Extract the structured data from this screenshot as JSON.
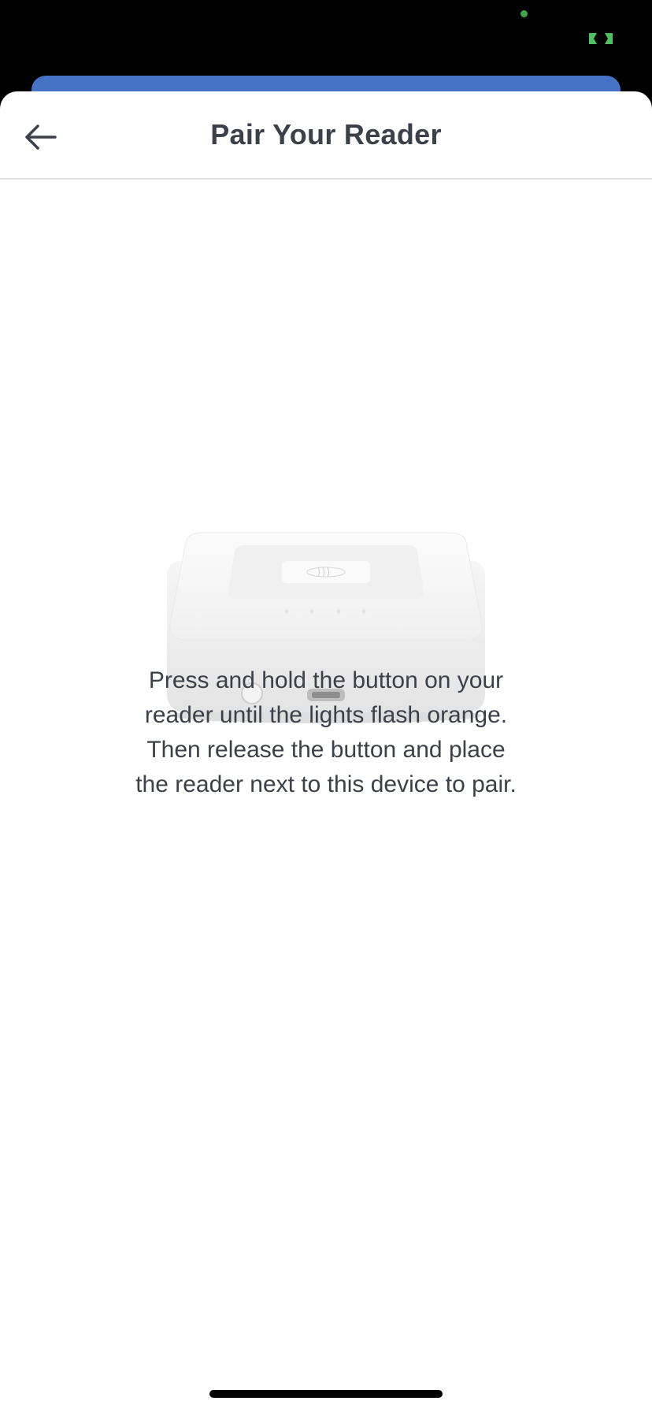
{
  "colors": {
    "accent_behind": "#4672c3",
    "title_text": "#3c4149",
    "status_green": "#3ca64a"
  },
  "nav": {
    "back_icon": "arrow-left-icon",
    "title": "Pair Your Reader"
  },
  "illustration": {
    "icon": "card-reader-icon"
  },
  "instructions": {
    "text": "Press and hold the button on your reader until the lights flash orange. Then release the button and place the reader next to this device to pair."
  }
}
